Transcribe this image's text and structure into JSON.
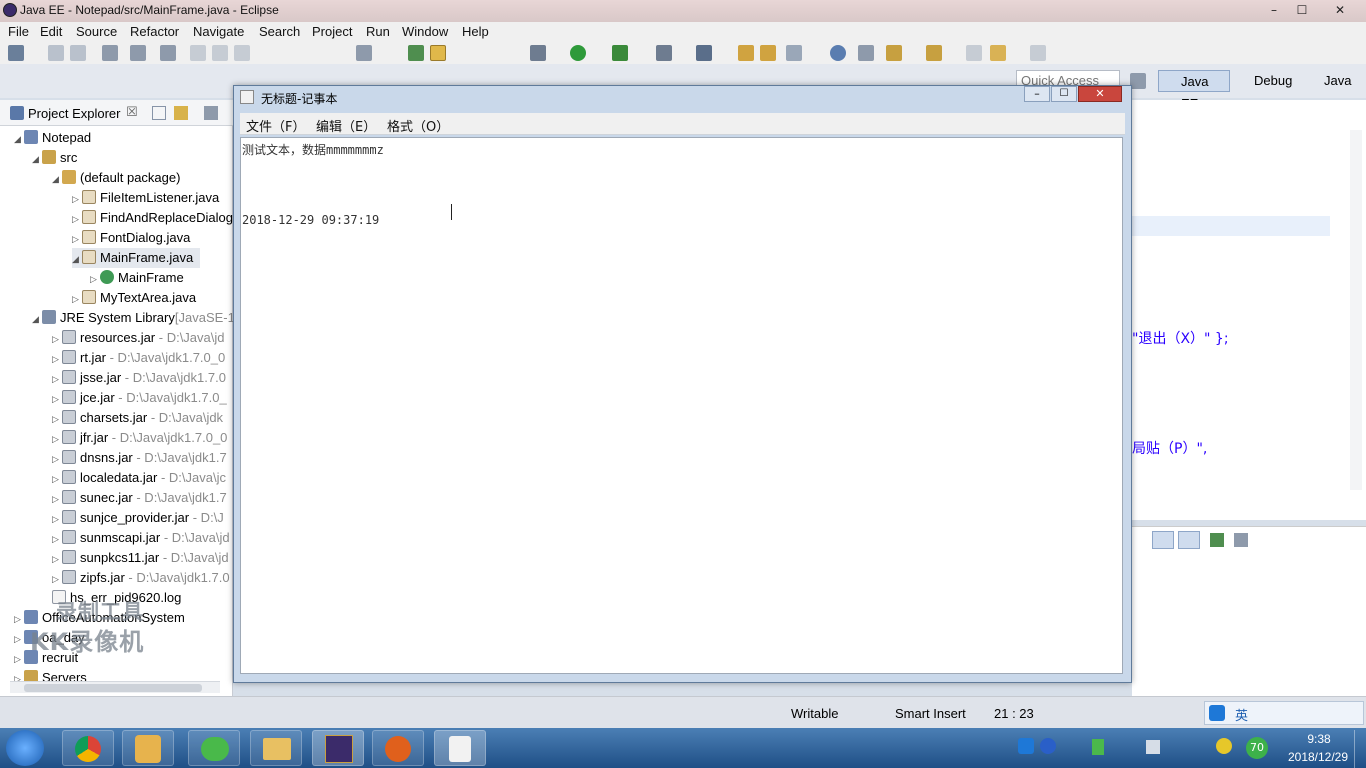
{
  "window": {
    "title": "Java EE - Notepad/src/MainFrame.java - Eclipse",
    "min": "–",
    "max": "☐",
    "close": "✕"
  },
  "menu": [
    "File",
    "Edit",
    "Source",
    "Refactor",
    "Navigate",
    "Search",
    "Project",
    "Run",
    "Window",
    "Help"
  ],
  "perspectives": {
    "quick_access": "Quick Access",
    "items": [
      "Java EE",
      "Debug",
      "Java"
    ]
  },
  "explorer": {
    "title": "Project Explorer",
    "close": "☒",
    "nodes": [
      {
        "label": "Notepad",
        "suffix": ""
      },
      {
        "label": "src",
        "suffix": ""
      },
      {
        "label": "(default package)",
        "suffix": ""
      },
      {
        "label": "FileItemListener.java",
        "suffix": ""
      },
      {
        "label": "FindAndReplaceDialog",
        "suffix": ""
      },
      {
        "label": "FontDialog.java",
        "suffix": ""
      },
      {
        "label": "MainFrame.java",
        "suffix": ""
      },
      {
        "label": "MainFrame",
        "suffix": ""
      },
      {
        "label": "MyTextArea.java",
        "suffix": ""
      },
      {
        "label": "JRE System Library",
        "suffix": "[JavaSE-1"
      },
      {
        "label": "resources.jar",
        "suffix": " - D:\\Java\\jd"
      },
      {
        "label": "rt.jar",
        "suffix": " - D:\\Java\\jdk1.7.0_0"
      },
      {
        "label": "jsse.jar",
        "suffix": " - D:\\Java\\jdk1.7.0"
      },
      {
        "label": "jce.jar",
        "suffix": " - D:\\Java\\jdk1.7.0_"
      },
      {
        "label": "charsets.jar",
        "suffix": " - D:\\Java\\jdk"
      },
      {
        "label": "jfr.jar",
        "suffix": " - D:\\Java\\jdk1.7.0_0"
      },
      {
        "label": "dnsns.jar",
        "suffix": " - D:\\Java\\jdk1.7"
      },
      {
        "label": "localedata.jar",
        "suffix": " - D:\\Java\\jc"
      },
      {
        "label": "sunec.jar",
        "suffix": " - D:\\Java\\jdk1.7"
      },
      {
        "label": "sunjce_provider.jar",
        "suffix": " - D:\\J"
      },
      {
        "label": "sunmscapi.jar",
        "suffix": " - D:\\Java\\jd"
      },
      {
        "label": "sunpkcs11.jar",
        "suffix": " - D:\\Java\\jd"
      },
      {
        "label": "zipfs.jar",
        "suffix": " - D:\\Java\\jdk1.7.0"
      },
      {
        "label": "hs_err_pid9620.log",
        "suffix": ""
      },
      {
        "label": "OfficeAutomationSystem",
        "suffix": ""
      },
      {
        "label": "oa_day",
        "suffix": ""
      },
      {
        "label": "recruit",
        "suffix": ""
      },
      {
        "label": "Servers",
        "suffix": ""
      }
    ]
  },
  "editor": {
    "frag1": "\"退出（X）\" };",
    "frag2": "局贴（P）\","
  },
  "watermark": {
    "line1": "录制工具",
    "line2": "KK录像机"
  },
  "notepad": {
    "title": "无标题-记事本",
    "menu": [
      "文件（F）",
      "编辑（E）",
      "格式（O）"
    ],
    "line1": "测试文本，数据mmmmmmmz",
    "line2": "2018-12-29 09:37:19"
  },
  "status": {
    "writable": "Writable",
    "insert": "Smart Insert",
    "position": "21 : 23"
  },
  "tray": {
    "ime": "英",
    "badge": "70",
    "time": "9:38",
    "date": "2018/12/29"
  },
  "colors": {
    "accent": "#0b64c0",
    "taskbar": "#2a5d95"
  }
}
